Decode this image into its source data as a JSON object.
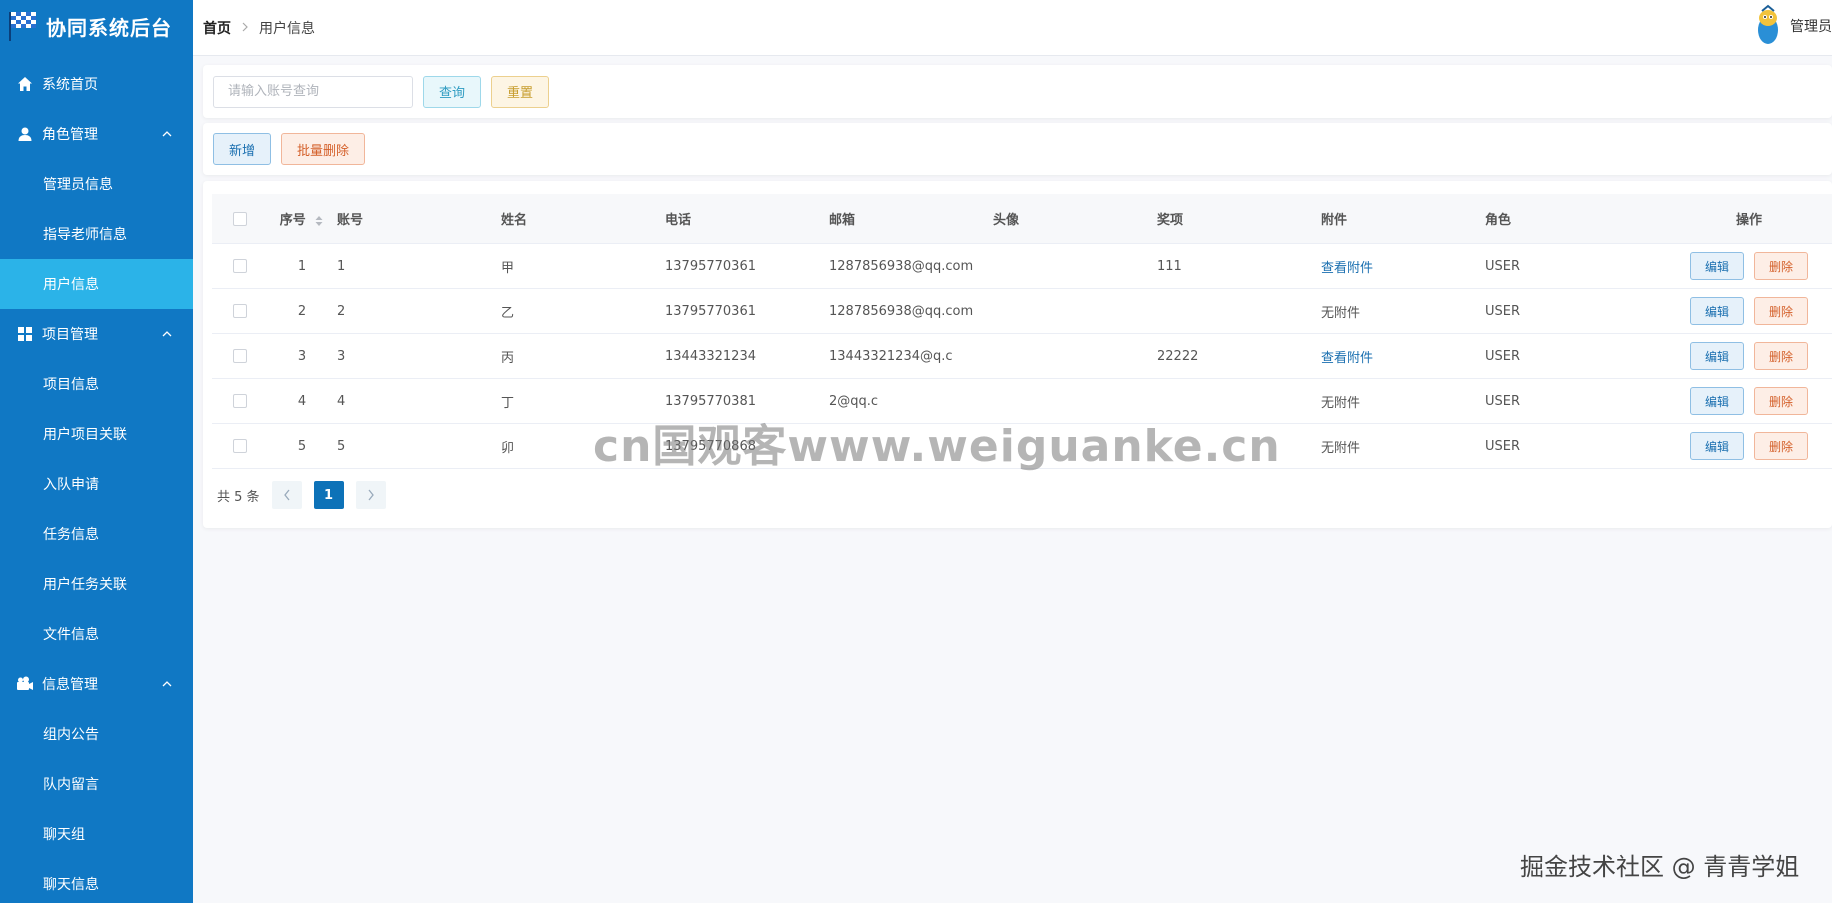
{
  "brand": {
    "title": "协同系统后台"
  },
  "sidebar": {
    "items": [
      {
        "label": "系统首页",
        "icon": "home-icon"
      },
      {
        "label": "角色管理",
        "icon": "user-icon",
        "expanded": true,
        "children": [
          "管理员信息",
          "指导老师信息",
          "用户信息"
        ]
      },
      {
        "label": "项目管理",
        "icon": "grid-icon",
        "expanded": true,
        "children": [
          "项目信息",
          "用户项目关联",
          "入队申请",
          "任务信息",
          "用户任务关联",
          "文件信息"
        ]
      },
      {
        "label": "信息管理",
        "icon": "camera-icon",
        "expanded": true,
        "children": [
          "组内公告",
          "队内留言",
          "聊天组",
          "聊天信息"
        ]
      }
    ],
    "active": "用户信息",
    "colors": {
      "bg": "#1078c4",
      "active": "#2bb3e8"
    }
  },
  "header": {
    "breadcrumb_home": "首页",
    "breadcrumb_current": "用户信息",
    "user_name": "管理员"
  },
  "search": {
    "placeholder": "请输入账号查询",
    "value": "",
    "query_label": "查询",
    "reset_label": "重置"
  },
  "actions": {
    "add_label": "新增",
    "batch_delete_label": "批量删除"
  },
  "table": {
    "columns": [
      "序号",
      "账号",
      "姓名",
      "电话",
      "邮箱",
      "头像",
      "奖项",
      "附件",
      "角色",
      "操作"
    ],
    "rows": [
      {
        "seq": "1",
        "account": "1",
        "name": "甲",
        "phone": "13795770361",
        "email": "1287856938@qq.com",
        "avatar": "",
        "award": "111",
        "attachment": "查看附件",
        "has_attachment": true,
        "role": "USER"
      },
      {
        "seq": "2",
        "account": "2",
        "name": "乙",
        "phone": "13795770361",
        "email": "1287856938@qq.com",
        "avatar": "",
        "award": "",
        "attachment": "无附件",
        "has_attachment": false,
        "role": "USER"
      },
      {
        "seq": "3",
        "account": "3",
        "name": "丙",
        "phone": "13443321234",
        "email": "13443321234@q.c",
        "avatar": "",
        "award": "22222",
        "attachment": "查看附件",
        "has_attachment": true,
        "role": "USER"
      },
      {
        "seq": "4",
        "account": "4",
        "name": "丁",
        "phone": "13795770381",
        "email": "2@qq.c",
        "avatar": "",
        "award": "",
        "attachment": "无附件",
        "has_attachment": false,
        "role": "USER"
      },
      {
        "seq": "5",
        "account": "5",
        "name": "卯",
        "phone": "13795770868",
        "email": "",
        "avatar": "",
        "award": "",
        "attachment": "无附件",
        "has_attachment": false,
        "role": "USER"
      }
    ],
    "edit_label": "编辑",
    "delete_label": "删除"
  },
  "pagination": {
    "total_text": "共 5 条",
    "current_page": "1"
  },
  "watermark": "cn国观客www.weiguanke.cn",
  "footer_watermark": "掘金技术社区 @ 青青学姐"
}
